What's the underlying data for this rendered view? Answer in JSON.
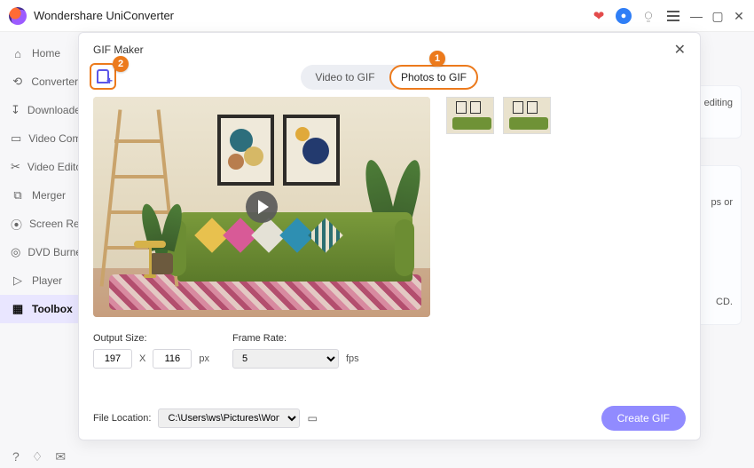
{
  "app": {
    "title": "Wondershare UniConverter"
  },
  "sidebar": {
    "items": [
      {
        "label": "Home",
        "icon": "⌂"
      },
      {
        "label": "Converter",
        "icon": "⟲"
      },
      {
        "label": "Downloader",
        "icon": "↧"
      },
      {
        "label": "Video Compressor",
        "icon": "▭"
      },
      {
        "label": "Video Editor",
        "icon": "✂"
      },
      {
        "label": "Merger",
        "icon": "⧉"
      },
      {
        "label": "Screen Recorder",
        "icon": "⦿"
      },
      {
        "label": "DVD Burner",
        "icon": "◎"
      },
      {
        "label": "Player",
        "icon": "▷"
      },
      {
        "label": "Toolbox",
        "icon": "▦"
      }
    ]
  },
  "background_hints": {
    "line1": "editing",
    "line2": "ps or",
    "line3": "CD."
  },
  "modal": {
    "title": "GIF Maker",
    "tabs": {
      "video": "Video to GIF",
      "photos": "Photos to GIF"
    },
    "callouts": {
      "tab": "1",
      "add": "2"
    },
    "output": {
      "label": "Output Size:",
      "width": "197",
      "sep": "X",
      "height": "116",
      "unit": "px"
    },
    "frame": {
      "label": "Frame Rate:",
      "value": "5",
      "unit": "fps"
    },
    "location": {
      "label": "File Location:",
      "path": "C:\\Users\\ws\\Pictures\\Wondersh"
    },
    "create": "Create GIF"
  }
}
